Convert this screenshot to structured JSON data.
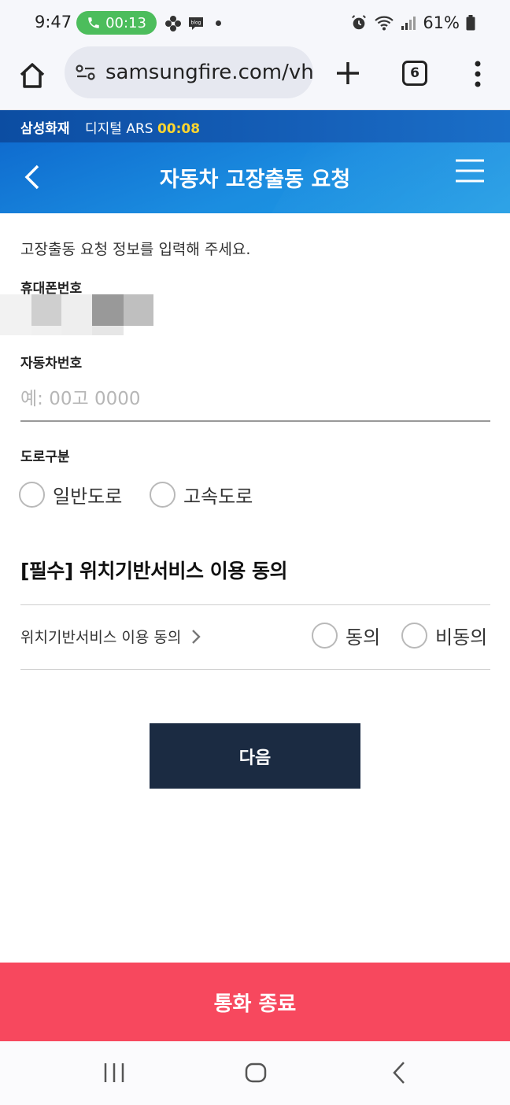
{
  "status_bar": {
    "time": "9:47",
    "call_timer": "00:13",
    "battery": "61%",
    "icons": [
      "phone-icon",
      "flower-icon",
      "blog-icon",
      "alarm-icon",
      "wifi-icon",
      "signal-icon",
      "battery-icon"
    ]
  },
  "browser": {
    "url": "samsungfire.com/vh",
    "tab_count": "6",
    "icons": [
      "home-icon",
      "site-settings-icon",
      "plus-icon",
      "more-vert-icon"
    ]
  },
  "ars": {
    "brand": "삼성화재",
    "label": "디지털 ARS",
    "timer": "00:08"
  },
  "header": {
    "title": "자동차 고장출동 요청"
  },
  "form": {
    "intro": "고장출동 요청 정보를 입력해 주세요.",
    "phone_label": "휴대폰번호",
    "car_label": "자동차번호",
    "car_placeholder": "예: 00고 0000",
    "road_label": "도로구분",
    "road_options": [
      "일반도로",
      "고속도로"
    ]
  },
  "consent": {
    "section_title": "[필수] 위치기반서비스 이용 동의",
    "link_text": "위치기반서비스 이용 동의",
    "options": [
      "동의",
      "비동의"
    ]
  },
  "buttons": {
    "next": "다음",
    "end_call": "통화 종료"
  },
  "colors": {
    "header_blue": "#1b8de0",
    "ars_bar": "#0c4da2",
    "timer_yellow": "#ffd630",
    "next_button": "#1b2b42",
    "end_call": "#f7485e",
    "call_pill": "#4cbd5c"
  }
}
